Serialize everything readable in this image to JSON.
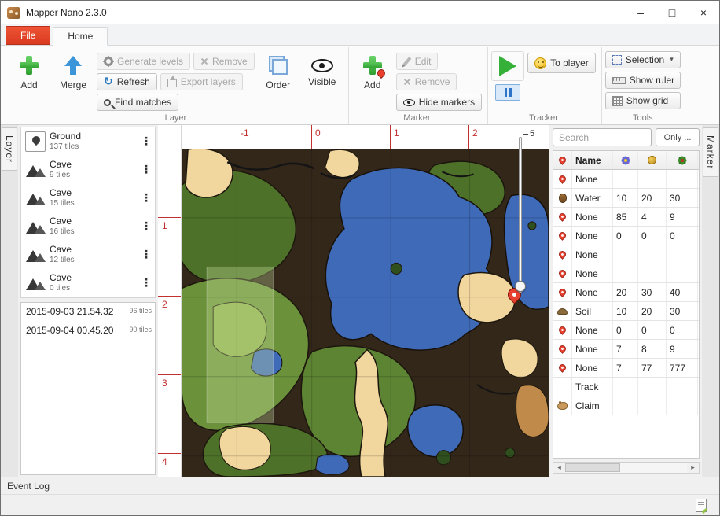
{
  "window": {
    "title": "Mapper Nano 2.3.0",
    "minimize": "–",
    "maximize": "□",
    "close": "×"
  },
  "tabs": {
    "file": "File",
    "home": "Home"
  },
  "icons": {
    "kebab": "⋮",
    "dropdown": "▾",
    "refresh": "↻",
    "scroll_left": "◂",
    "scroll_right": "▸"
  },
  "colors": {
    "accent_red": "#e8402f",
    "file_tab": "#d93a20",
    "ruler_red": "#c23030",
    "tracker_green": "#35b13a",
    "pause_blue": "#2e75c8"
  },
  "ribbon": {
    "layer": {
      "label": "Layer",
      "add": "Add",
      "merge": "Merge",
      "generate_levels": "Generate levels",
      "remove": "Remove",
      "refresh": "Refresh",
      "export_layers": "Export layers",
      "find_matches": "Find matches",
      "order": "Order",
      "visible": "Visible"
    },
    "marker": {
      "label": "Marker",
      "add": "Add",
      "edit": "Edit",
      "remove": "Remove",
      "hide_markers": "Hide markers"
    },
    "tracker": {
      "label": "Tracker",
      "to_player": "To player"
    },
    "tools": {
      "label": "Tools",
      "selection": "Selection",
      "show_ruler": "Show ruler",
      "show_grid": "Show grid"
    }
  },
  "left_panel": {
    "tab": "Layer",
    "layers": [
      {
        "icon": "ground",
        "name": "Ground",
        "tiles": "137 tiles"
      },
      {
        "icon": "cave",
        "name": "Cave",
        "tiles": "9 tiles"
      },
      {
        "icon": "cave",
        "name": "Cave",
        "tiles": "15 tiles"
      },
      {
        "icon": "cave",
        "name": "Cave",
        "tiles": "16 tiles"
      },
      {
        "icon": "cave",
        "name": "Cave",
        "tiles": "12 tiles"
      },
      {
        "icon": "cave",
        "name": "Cave",
        "tiles": "0 tiles"
      }
    ],
    "history": [
      {
        "timestamp": "2015-09-03 21.54.32",
        "tiles": "96 tiles"
      },
      {
        "timestamp": "2015-09-04 00.45.20",
        "tiles": "90 tiles"
      }
    ]
  },
  "map": {
    "ruler_x": [
      "-1",
      "0",
      "1",
      "2"
    ],
    "ruler_y": [
      "1",
      "2",
      "3",
      "4"
    ],
    "slider_max": "5"
  },
  "right_panel": {
    "tab": "Marker",
    "search_placeholder": "Search",
    "only_label": "Only ...",
    "table": {
      "headers": {
        "col1_icon": "pin",
        "name": "Name",
        "col3_icon": "flower",
        "col4_icon": "gold",
        "col5_icon": "plant"
      },
      "rows": [
        {
          "icon": "pin",
          "name": "None",
          "c1": "",
          "c2": "",
          "c3": ""
        },
        {
          "icon": "water",
          "name": "Water",
          "c1": "10",
          "c2": "20",
          "c3": "30"
        },
        {
          "icon": "pin",
          "name": "None",
          "c1": "85",
          "c2": "4",
          "c3": "9"
        },
        {
          "icon": "pin",
          "name": "None",
          "c1": "0",
          "c2": "0",
          "c3": "0"
        },
        {
          "icon": "pin",
          "name": "None",
          "c1": "",
          "c2": "",
          "c3": ""
        },
        {
          "icon": "pin",
          "name": "None",
          "c1": "",
          "c2": "",
          "c3": ""
        },
        {
          "icon": "pin",
          "name": "None",
          "c1": "20",
          "c2": "30",
          "c3": "40"
        },
        {
          "icon": "soil",
          "name": "Soil",
          "c1": "10",
          "c2": "20",
          "c3": "30"
        },
        {
          "icon": "pin",
          "name": "None",
          "c1": "0",
          "c2": "0",
          "c3": "0"
        },
        {
          "icon": "pin",
          "name": "None",
          "c1": "7",
          "c2": "8",
          "c3": "9"
        },
        {
          "icon": "pin",
          "name": "None",
          "c1": "7",
          "c2": "77",
          "c3": "777"
        },
        {
          "icon": "none",
          "name": "Track",
          "c1": "",
          "c2": "",
          "c3": ""
        },
        {
          "icon": "claim",
          "name": "Claim",
          "c1": "",
          "c2": "",
          "c3": ""
        }
      ]
    }
  },
  "bottom": {
    "event_log": "Event Log"
  }
}
